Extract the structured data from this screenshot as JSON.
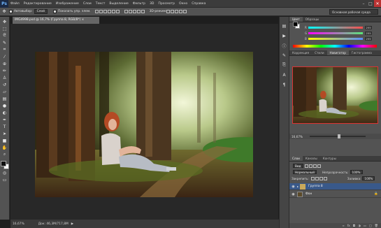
{
  "menubar": {
    "logo": "Ps",
    "items": [
      "Файл",
      "Редактирование",
      "Изображение",
      "Слои",
      "Текст",
      "Выделение",
      "Фильтр",
      "3D",
      "Просмотр",
      "Окно",
      "Справка"
    ],
    "minimize": "–",
    "maximize": "□",
    "close": "✕"
  },
  "options": {
    "auto_select_label": "Автовыбор:",
    "auto_select_value": "Слой",
    "transform_label": "Показать упр. элем.",
    "mode_3d": "3D-режим:",
    "workspace": "Основная рабочая среда"
  },
  "document": {
    "tab_title": "IMG4998.psd @ 16,7% (Группа 8, RGB/8*) ×",
    "zoom": "16,67%",
    "doc_info": "Док: 46,3М/717,8М",
    "status_arrow": "▶"
  },
  "color_panel": {
    "tabs": [
      "Цвет",
      "Образцы"
    ],
    "sliders": [
      {
        "label": "R",
        "value": "255",
        "color": "#ff4b4b"
      },
      {
        "label": "G",
        "value": "255",
        "color": "#58e878"
      },
      {
        "label": "B",
        "value": "255",
        "color": "#5a8cff"
      }
    ]
  },
  "navigator_panel": {
    "tabs": [
      "Коррекция",
      "Стили",
      "Навигатор",
      "Гистограмма"
    ],
    "zoom": "16,67%"
  },
  "layers_panel": {
    "tabs": [
      "Слои",
      "Каналы",
      "Контуры"
    ],
    "filter_label": "Вид",
    "blend_mode": "Нормальный",
    "opacity_label": "Непрозрачность:",
    "opacity_value": "100%",
    "lock_label": "Закрепить:",
    "fill_label": "Заливка:",
    "fill_value": "100%",
    "layers": [
      {
        "name": "Группа 8",
        "selected": true
      },
      {
        "name": "Фон",
        "selected": false
      }
    ],
    "footer_icons": [
      "link-icon",
      "fx-icon",
      "mask-icon",
      "adjust-icon",
      "folder-icon",
      "new-layer-icon",
      "trash-icon"
    ]
  },
  "colors": {
    "accent_selection": "#39598a",
    "navigator_frame": "#dd3333"
  }
}
